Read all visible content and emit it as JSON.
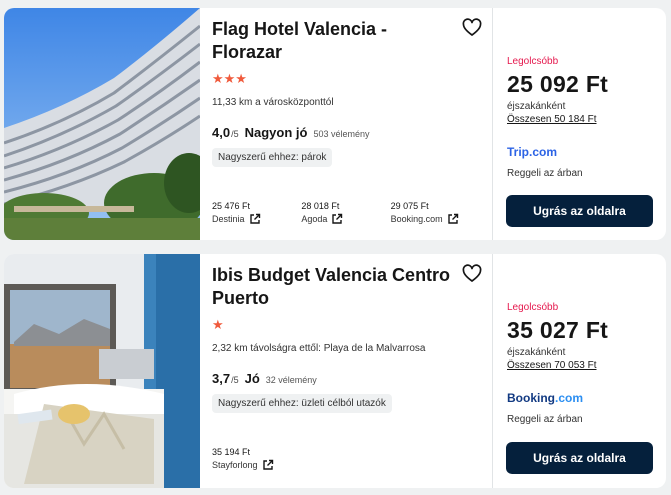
{
  "hotels": [
    {
      "name": "Flag Hotel Valencia - Florazar",
      "stars": "★★★",
      "distance": "11,33 km a városközponttól",
      "score": "4,0",
      "scale": "/5",
      "rating_label": "Nagyon jó",
      "reviews": "503 vélemény",
      "tag": "Nagyszerű ehhez: párok",
      "offers": [
        {
          "price": "25 476 Ft",
          "site": "Destinia"
        },
        {
          "price": "28 018 Ft",
          "site": "Agoda"
        },
        {
          "price": "29 075 Ft",
          "site": "Booking.com"
        }
      ],
      "cheapest_label": "Legolcsóbb",
      "price": "25 092 Ft",
      "per_night": "éjszakánként",
      "total": "Összesen 50 184 Ft",
      "provider": "Trip.com",
      "breakfast": "Reggeli az árban",
      "button": "Ugrás az oldalra"
    },
    {
      "name": "Ibis Budget Valencia Centro Puerto",
      "stars": "★",
      "distance": "2,32 km távolságra ettől: Playa de la Malvarrosa",
      "score": "3,7",
      "scale": "/5",
      "rating_label": "Jó",
      "reviews": "32 vélemény",
      "tag": "Nagyszerű ehhez: üzleti célból utazók",
      "offers": [
        {
          "price": "35 194 Ft",
          "site": "Stayforlong"
        }
      ],
      "cheapest_label": "Legolcsóbb",
      "price": "35 027 Ft",
      "per_night": "éjszakánként",
      "total": "Összesen 70 053 Ft",
      "provider_main": "Booking",
      "provider_dot": ".com",
      "breakfast": "Reggeli az árban",
      "button": "Ugrás az oldalra"
    }
  ],
  "colors": {
    "accent_red": "#e5184d",
    "star_orange": "#f05a3c",
    "button_navy": "#05203c",
    "trip_blue": "#2c63e5",
    "booking_navy": "#123a82"
  }
}
